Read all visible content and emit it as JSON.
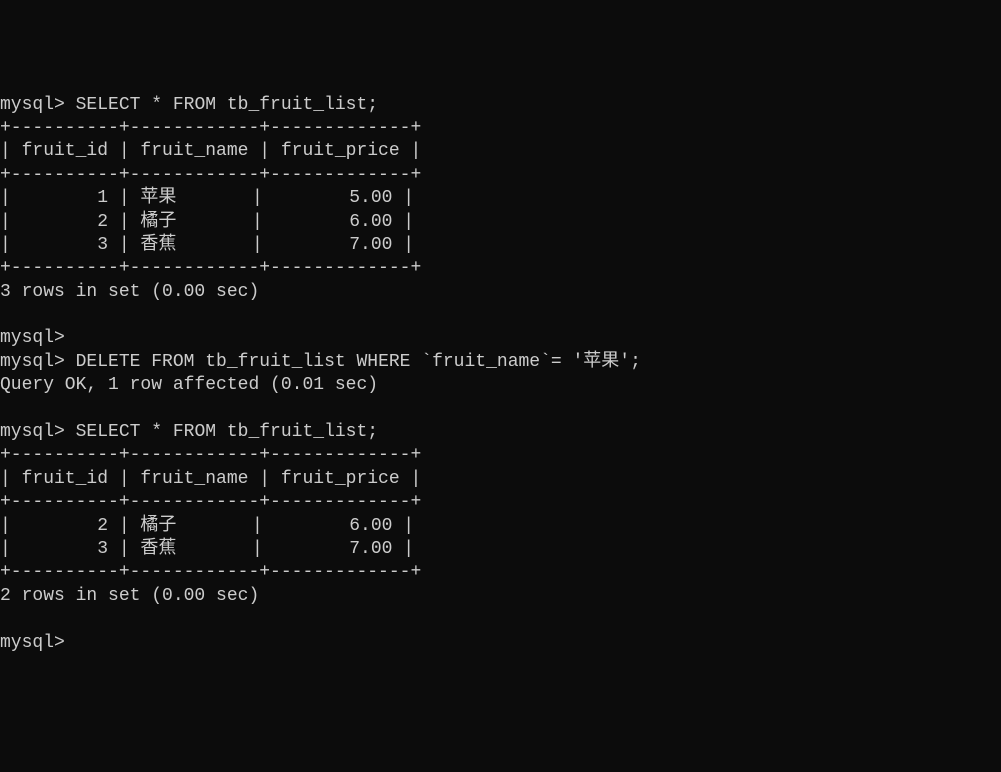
{
  "prompt": "mysql>",
  "query1": {
    "sql": "SELECT * FROM tb_fruit_list;",
    "border_top": "+----------+------------+-------------+",
    "header": "| fruit_id | fruit_name | fruit_price |",
    "border_mid": "+----------+------------+-------------+",
    "rows": [
      "|        1 | 苹果       |        5.00 |",
      "|        2 | 橘子       |        6.00 |",
      "|        3 | 香蕉       |        7.00 |"
    ],
    "border_bot": "+----------+------------+-------------+",
    "result": "3 rows in set (0.00 sec)"
  },
  "query2": {
    "sql": "DELETE FROM tb_fruit_list WHERE `fruit_name`= '苹果';",
    "result": "Query OK, 1 row affected (0.01 sec)"
  },
  "query3": {
    "sql": "SELECT * FROM tb_fruit_list;",
    "border_top": "+----------+------------+-------------+",
    "header": "| fruit_id | fruit_name | fruit_price |",
    "border_mid": "+----------+------------+-------------+",
    "rows": [
      "|        2 | 橘子       |        6.00 |",
      "|        3 | 香蕉       |        7.00 |"
    ],
    "border_bot": "+----------+------------+-------------+",
    "result": "2 rows in set (0.00 sec)"
  }
}
